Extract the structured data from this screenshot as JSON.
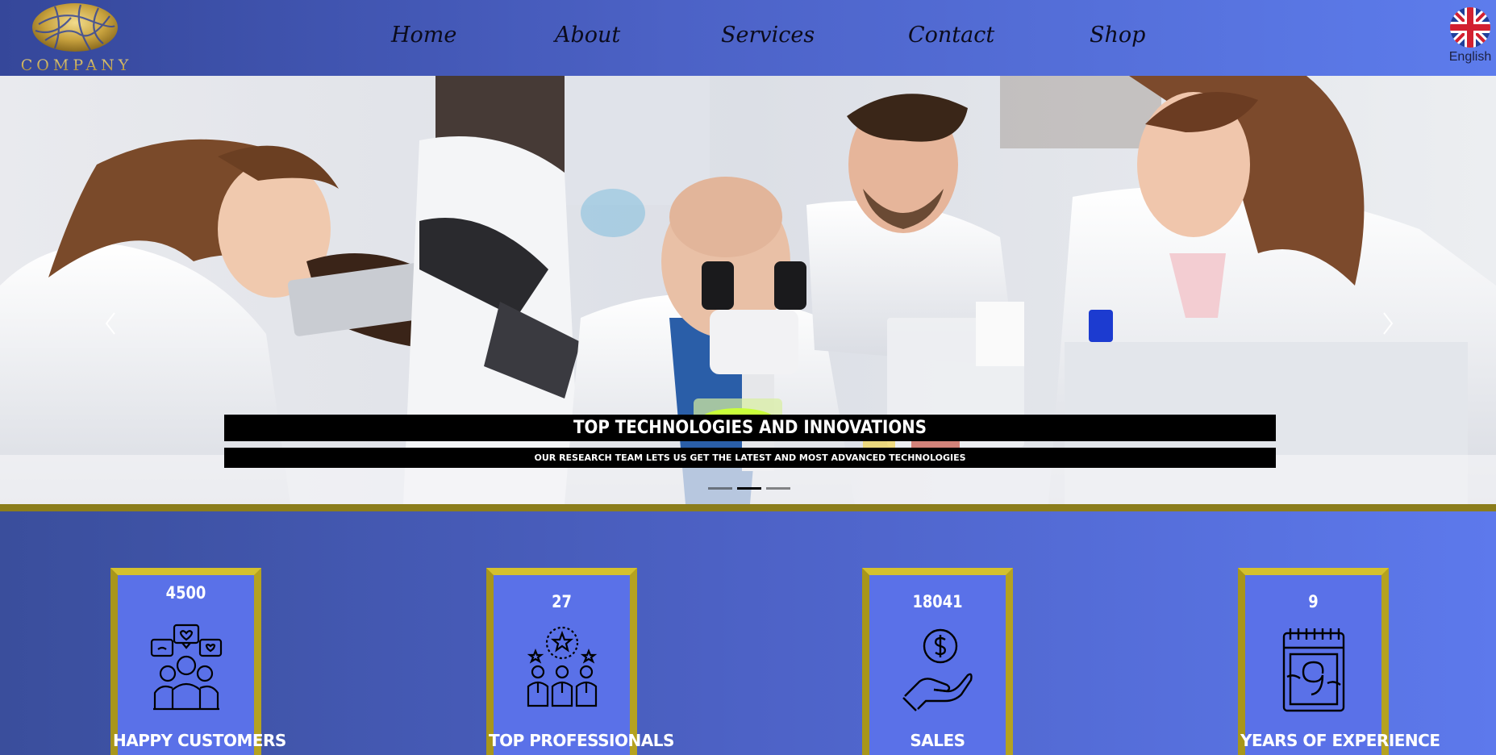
{
  "header": {
    "logo_text": "COMPANY",
    "nav": [
      {
        "label": "Home"
      },
      {
        "label": "About"
      },
      {
        "label": "Services"
      },
      {
        "label": "Contact"
      },
      {
        "label": "Shop"
      }
    ],
    "language": {
      "label": "English",
      "flag_icon": "uk-flag-icon"
    }
  },
  "hero": {
    "title": "TOP TECHNOLOGIES AND INNOVATIONS",
    "subtitle": "OUR RESEARCH TEAM LETS US GET THE LATEST AND MOST ADVANCED TECHNOLOGIES",
    "slides_count": 3,
    "active_slide": 2
  },
  "stats": [
    {
      "number": "4500",
      "label": "HAPPY CUSTOMERS",
      "icon": "happy-customers-icon"
    },
    {
      "number": "27",
      "label": "TOP PROFESSIONALS",
      "icon": "top-professionals-icon"
    },
    {
      "number": "18041",
      "label": "SALES",
      "icon": "sales-icon"
    },
    {
      "number": "9",
      "label": "YEARS OF EXPERIENCE",
      "icon": "calendar-icon"
    }
  ],
  "colors": {
    "header_start": "#35479a",
    "header_end": "#5d7cec",
    "gold_border": "#b5a21f",
    "divider": "#8b7d1c",
    "stat_bg": "#5a71e8"
  }
}
